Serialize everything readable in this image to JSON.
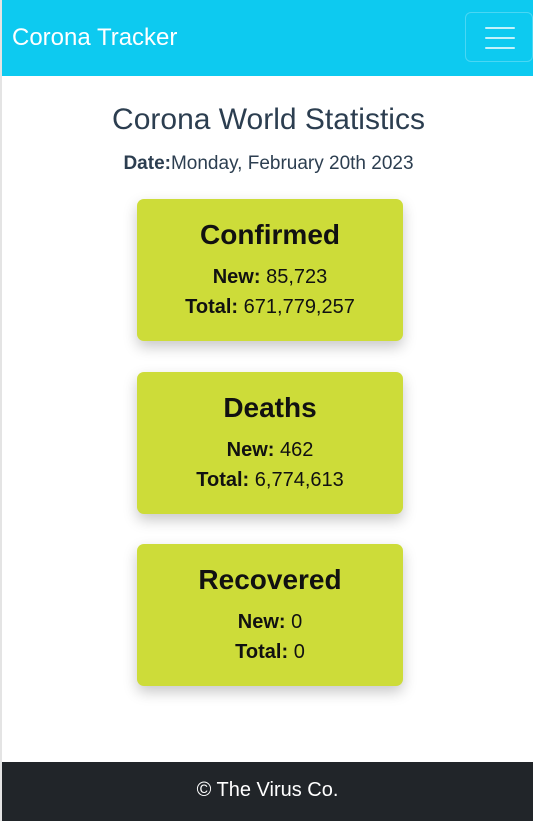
{
  "navbar": {
    "brand": "Corona Tracker",
    "toggler_icon": "hamburger-menu-icon"
  },
  "main": {
    "title": "Corona World Statistics",
    "date_label": "Date:",
    "date_value": "Monday, February 20th 2023",
    "cards": [
      {
        "title": "Confirmed",
        "new_label": "New:",
        "new_value": "85,723",
        "total_label": "Total:",
        "total_value": "671,779,257"
      },
      {
        "title": "Deaths",
        "new_label": "New:",
        "new_value": "462",
        "total_label": "Total:",
        "total_value": "6,774,613"
      },
      {
        "title": "Recovered",
        "new_label": "New:",
        "new_value": "0",
        "total_label": "Total:",
        "total_value": "0"
      }
    ]
  },
  "footer": {
    "text": "© The Virus Co."
  },
  "colors": {
    "navbar": "#0dcaf0",
    "card": "#cddc39",
    "footer": "#212529",
    "heading": "#2c3e50"
  }
}
